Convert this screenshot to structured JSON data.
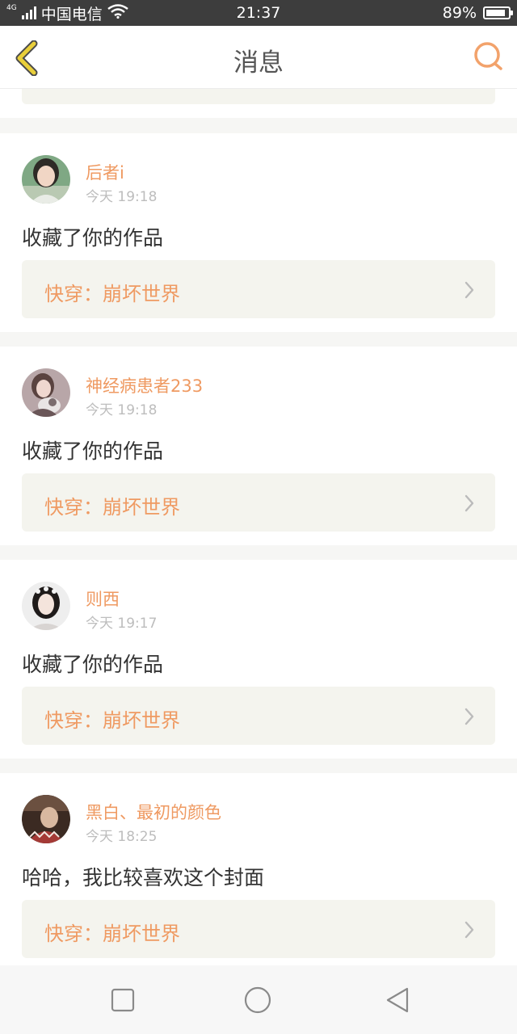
{
  "status_bar": {
    "network_tag": "4G",
    "carrier": "中国电信",
    "time": "21:37",
    "battery_percent": "89%",
    "battery_level": 0.89,
    "icons": [
      "signal-icon",
      "wifi-icon",
      "battery-icon"
    ]
  },
  "header": {
    "title": "消息",
    "back_icon": "chevron-left-icon",
    "search_icon": "search-icon",
    "accent_color": "#f2a26b",
    "back_color": "#e9cf3a"
  },
  "messages": [
    {
      "user": "后者i",
      "time": "今天 19:18",
      "text": "收藏了你的作品",
      "work_title": "快穿：崩坏世界"
    },
    {
      "user": "神经病患者233",
      "time": "今天 19:18",
      "text": "收藏了你的作品",
      "work_title": "快穿：崩坏世界"
    },
    {
      "user": "则西",
      "time": "今天 19:17",
      "text": "收藏了你的作品",
      "work_title": "快穿：崩坏世界"
    },
    {
      "user": "黑白、最初的颜色",
      "time": "今天 18:25",
      "text": "哈哈，我比较喜欢这个封面",
      "work_title": "快穿：崩坏世界"
    }
  ],
  "nav_bar": {
    "icons": [
      "square-icon",
      "circle-icon",
      "back-triangle-icon"
    ]
  }
}
